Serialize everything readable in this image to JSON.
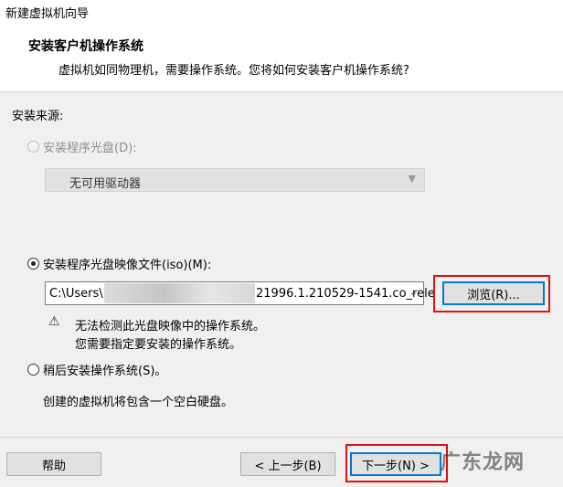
{
  "window": {
    "title": "新建虚拟机向导"
  },
  "header": {
    "title": "安装客户机操作系统",
    "subtitle": "虚拟机如同物理机，需要操作系统。您将如何安装客户机操作系统?"
  },
  "source": {
    "label": "安装来源:",
    "disc": {
      "label": "安装程序光盘(D):",
      "drive_value": "无可用驱动器",
      "selected": false,
      "enabled": false
    },
    "iso": {
      "label": "安装程序光盘映像文件(iso)(M):",
      "path_prefix": "C:\\Users\\",
      "path_suffix": "21996.1.210529-1541.co_rele",
      "selected": true,
      "browse_label": "浏览(R)..."
    },
    "warning": {
      "line1": "无法检测此光盘映像中的操作系统。",
      "line2": "您需要指定要安装的操作系统。"
    },
    "later": {
      "label": "稍后安装操作系统(S)。",
      "selected": false,
      "description": "创建的虚拟机将包含一个空白硬盘。"
    }
  },
  "footer": {
    "help_label": "帮助",
    "back_label": "< 上一步(B)",
    "next_label": "下一步(N) >",
    "watermark": "广东龙网"
  },
  "colors": {
    "highlight": "#e01010",
    "accent": "#0078d7"
  }
}
